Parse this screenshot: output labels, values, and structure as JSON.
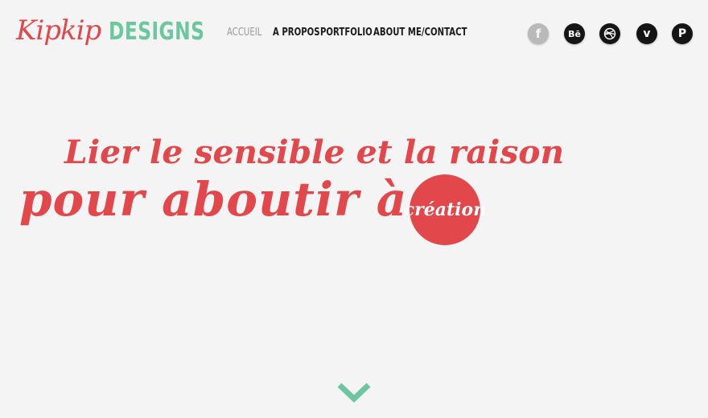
{
  "header": {
    "logo_script": "Kipkip",
    "logo_word": "DESIGNS"
  },
  "nav": {
    "items": [
      {
        "label": "ACCUEIL",
        "active": true
      },
      {
        "label": "A PROPOS",
        "active": false
      },
      {
        "label": "PORTFOLIO",
        "active": false
      },
      {
        "label": "ABOUT ME/CONTACT",
        "active": false
      }
    ]
  },
  "social": {
    "icons": [
      "facebook-icon",
      "behance-icon",
      "dribbble-icon",
      "vimeo-icon",
      "pinterest-icon"
    ],
    "glyphs": {
      "facebook": "f",
      "behance": "Bē",
      "vimeo": "v",
      "pinterest": "P"
    }
  },
  "hero": {
    "line1": "Lier le sensible et la raison",
    "line2": "pour aboutir à la",
    "highlight": "création"
  },
  "colors": {
    "accent_red": "#e2474b",
    "accent_green": "#6cc79f",
    "background": "#f4f4f4"
  }
}
